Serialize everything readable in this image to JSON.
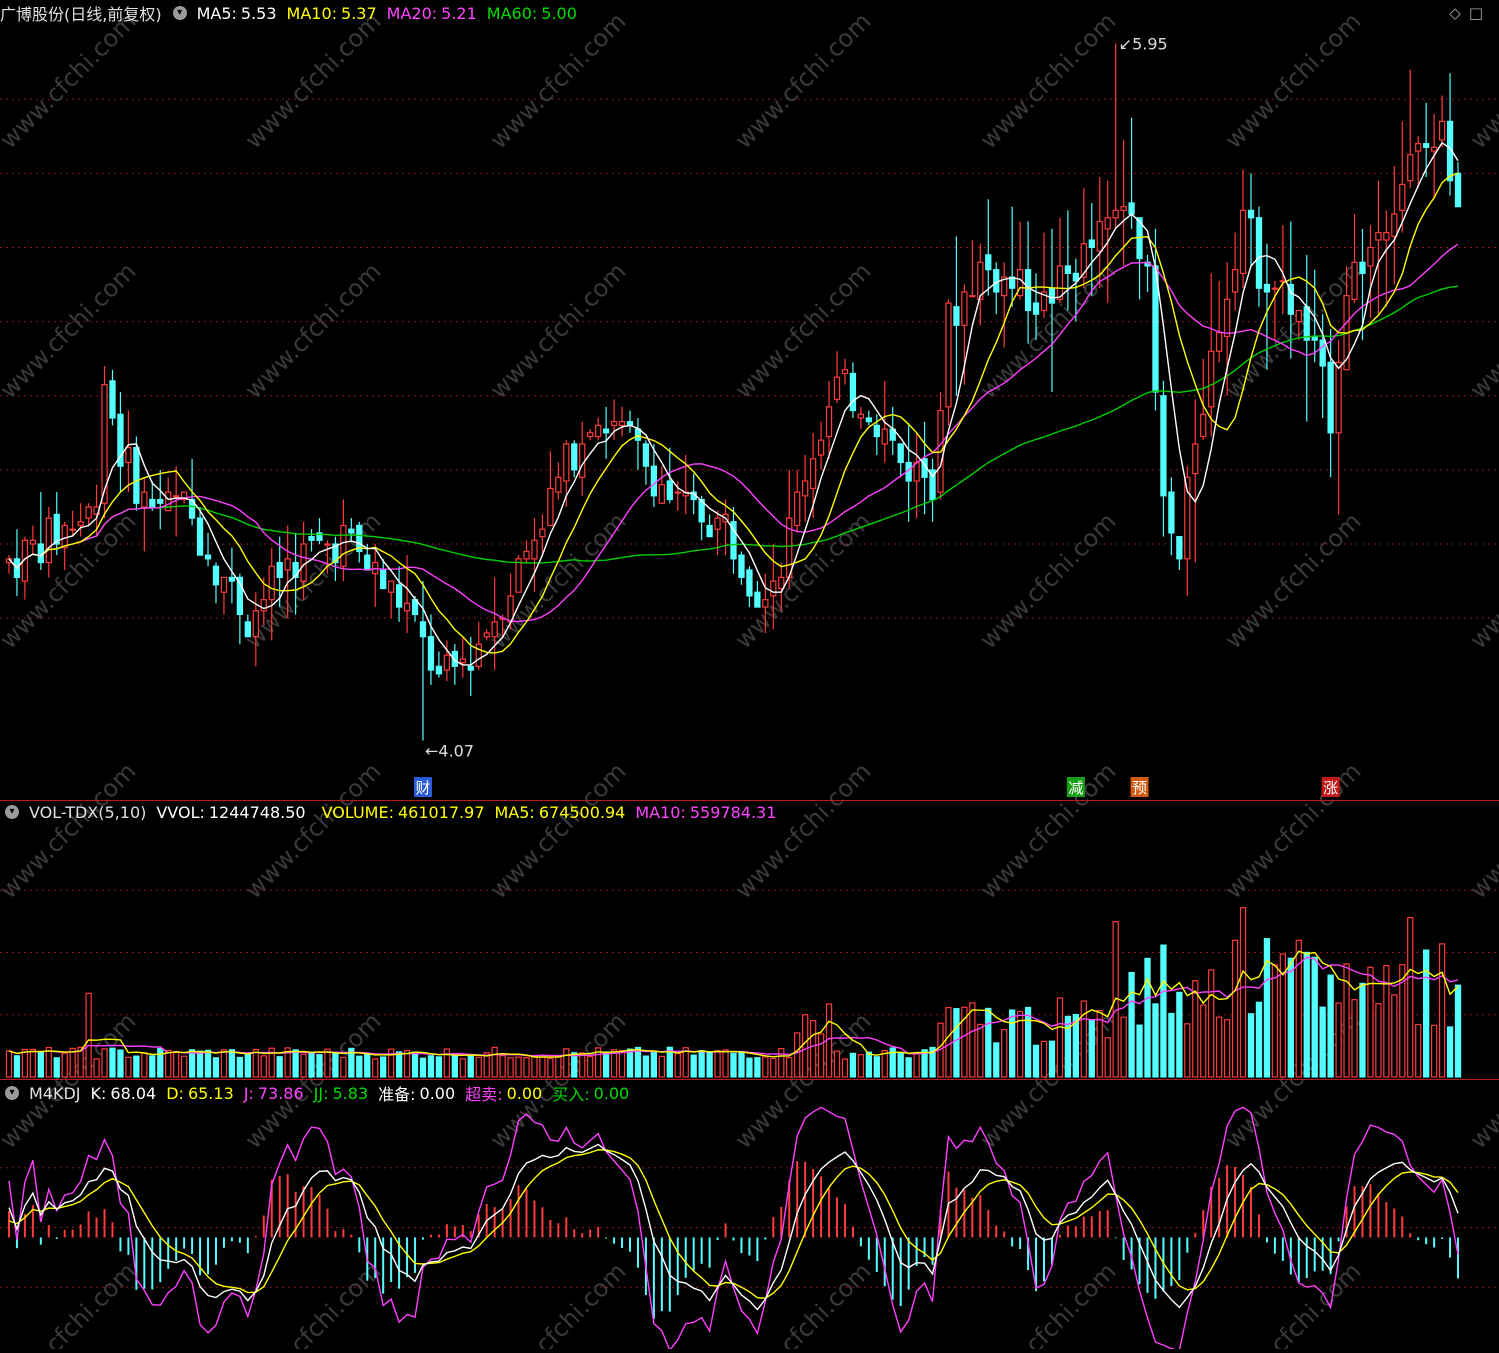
{
  "main_legend": {
    "title": "广博股份(日线,前复权)",
    "ma5_label": "MA5:",
    "ma5": "5.53",
    "ma10_label": "MA10:",
    "ma10": "5.37",
    "ma20_label": "MA20:",
    "ma20": "5.21",
    "ma60_label": "MA60:",
    "ma60": "5.00"
  },
  "vol_legend": {
    "title": "VOL-TDX(5,10)",
    "vvol_label": "VVOL:",
    "vvol": "1244748.50",
    "volume_label": "VOLUME:",
    "volume": "461017.97",
    "ma5_label": "MA5:",
    "ma5": "674500.94",
    "ma10_label": "MA10:",
    "ma10": "559784.31"
  },
  "kdj_legend": {
    "title": "M4KDJ",
    "k_label": "K:",
    "k": "68.04",
    "d_label": "D:",
    "d": "65.13",
    "j_label": "J:",
    "j": "73.86",
    "jj_label": "JJ:",
    "jj": "5.83",
    "prep_label": "准备:",
    "prep": "0.00",
    "oversold_label": "超卖:",
    "oversold": "0.00",
    "buy_label": "买入:",
    "buy": "0.00"
  },
  "top_icons": [
    "diamond-icon",
    "square-icon"
  ],
  "colors": {
    "up": "#ff3b3b",
    "down": "#54ffff",
    "ma5": "#ffffff",
    "ma10": "#ffff00",
    "ma20": "#ff40ff",
    "ma60": "#00d000",
    "grid": "#8a1515",
    "watermark": "#3a3a3a"
  },
  "chart_data": [
    {
      "type": "candlestick",
      "title": "广博股份(日线,前复权)",
      "ylim": [
        3.95,
        6.0
      ],
      "annotations": {
        "high": "5.95",
        "low": "4.07"
      },
      "event_markers": [
        {
          "index": 52,
          "text": "财",
          "color": "#2a5cd8"
        },
        {
          "index": 134,
          "text": "减",
          "color": "#18a018"
        },
        {
          "index": 142,
          "text": "预",
          "color": "#d05a10"
        },
        {
          "index": 166,
          "text": "涨",
          "color": "#c01818"
        }
      ],
      "ohlc_note": "values estimated from pixels, rounded to 0.01",
      "ohlc": []
    },
    {
      "type": "bar",
      "title": "VOL-TDX(5,10)",
      "ylim": [
        0,
        1250000
      ],
      "volume": []
    },
    {
      "type": "line",
      "title": "M4KDJ",
      "ylim": [
        -10,
        110
      ],
      "series": [
        "K",
        "D",
        "J"
      ]
    }
  ]
}
